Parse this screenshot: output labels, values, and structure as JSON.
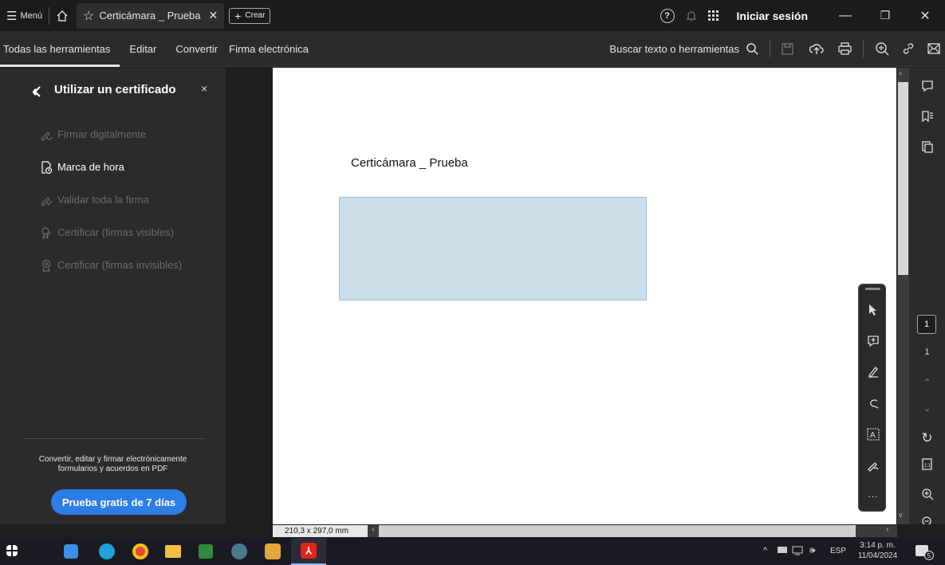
{
  "titlebar": {
    "menu_label": "Menú",
    "tab_title": "Certicámara _ Prueba",
    "create_label": "Crear",
    "signin_label": "Iniciar sesión"
  },
  "toolbar": {
    "tabs": [
      "Todas las herramientas",
      "Editar",
      "Convertir",
      "Firma electrónica"
    ],
    "search_label": "Buscar texto o herramientas"
  },
  "left_panel": {
    "title": "Utilizar un certificado",
    "items": [
      {
        "label": "Firmar digitalmente",
        "enabled": false
      },
      {
        "label": "Marca de hora",
        "enabled": true
      },
      {
        "label": "Validar toda la firma",
        "enabled": false
      },
      {
        "label": "Certificar (firmas visibles)",
        "enabled": false
      },
      {
        "label": "Certificar (firmas invisibles)",
        "enabled": false
      }
    ],
    "promo_text_1": "Convertir, editar y firmar electrónicamente",
    "promo_text_2": "formularios y acuerdos en PDF",
    "trial_button": "Prueba gratis de 7 días"
  },
  "document": {
    "heading": "Certicámara _ Prueba",
    "page_size": "210,3 x 297,0 mm"
  },
  "right_rail": {
    "page_current": "1",
    "page_total": "1"
  },
  "taskbar": {
    "language": "ESP",
    "time": "3:14 p. m.",
    "date": "11/04/2024",
    "notifications": "5"
  },
  "colors": {
    "accent": "#2d7de6",
    "signature_box": "#cadfea",
    "panel": "#2b2b2b",
    "background": "#1e1e1e"
  }
}
